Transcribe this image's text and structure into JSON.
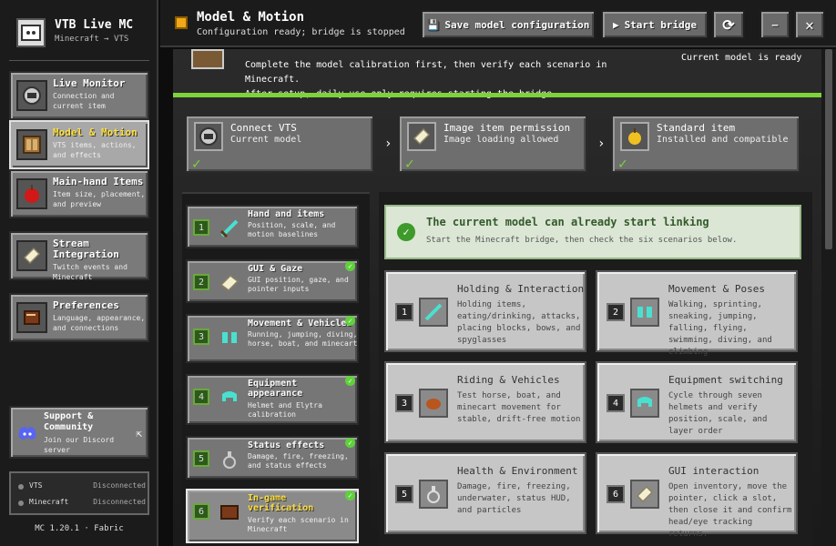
{
  "app": {
    "title": "VTB Live MC",
    "subtitle": "Minecraft → VTS"
  },
  "nav": [
    {
      "title": "Live Monitor",
      "desc": "Connection and current item",
      "icon": "monitor-icon"
    },
    {
      "title": "Model & Motion",
      "desc": "VTS items, actions, and effects",
      "icon": "cabinet-icon",
      "active": true
    },
    {
      "title": "Main-hand Items",
      "desc": "Item size, placement, and preview",
      "icon": "apple-icon"
    },
    {
      "title": "Stream Integration",
      "desc": "Twitch events and Minecraft",
      "icon": "paper-icon"
    },
    {
      "title": "Preferences",
      "desc": "Language, appearance, and connections",
      "icon": "book-icon"
    }
  ],
  "support": {
    "title": "Support & Community",
    "desc": "Join our Discord server"
  },
  "status": [
    {
      "label": "VTS",
      "value": "Disconnected"
    },
    {
      "label": "Minecraft",
      "value": "Disconnected"
    }
  ],
  "version": "MC 1.20.1 · Fabric",
  "header": {
    "title": "Model & Motion",
    "subtitle": "Configuration ready; bridge is stopped",
    "save_label": "Save model configuration",
    "start_label": "Start bridge"
  },
  "intro": {
    "line1": "Complete the model calibration first, then verify each scenario in Minecraft.",
    "line2": "After setup, daily use only requires starting the bridge.",
    "right": "Current model is ready"
  },
  "steps": [
    {
      "title": "Connect VTS",
      "desc": "Current model"
    },
    {
      "title": "Image item permission",
      "desc": "Image loading allowed"
    },
    {
      "title": "Standard item",
      "desc": "Installed and compatible"
    }
  ],
  "scenarios": [
    {
      "num": "1",
      "title": "Hand and items",
      "desc": "Position, scale, and motion baselines"
    },
    {
      "num": "2",
      "title": "GUI & Gaze",
      "desc": "GUI position, gaze, and pointer inputs"
    },
    {
      "num": "3",
      "title": "Movement & Vehicles",
      "desc": "Running, jumping, diving, horse, boat, and minecart"
    },
    {
      "num": "4",
      "title": "Equipment appearance",
      "desc": "Helmet and Elytra calibration"
    },
    {
      "num": "5",
      "title": "Status effects",
      "desc": "Damage, fire, freezing, and status effects"
    },
    {
      "num": "6",
      "title": "In-game verification",
      "desc": "Verify each scenario in Minecraft"
    }
  ],
  "ready": {
    "title": "The current model can already start linking",
    "desc": "Start the Minecraft bridge, then check the six scenarios below."
  },
  "cards": [
    {
      "num": "1",
      "title": "Holding & Interaction",
      "desc": "Holding items, eating/drinking, attacks, placing blocks, bows, and spyglasses"
    },
    {
      "num": "2",
      "title": "Movement & Poses",
      "desc": "Walking, sprinting, sneaking, jumping, falling, flying, swimming, diving, and climbing"
    },
    {
      "num": "3",
      "title": "Riding & Vehicles",
      "desc": "Test horse, boat, and minecart movement for stable, drift-free motion"
    },
    {
      "num": "4",
      "title": "Equipment switching",
      "desc": "Cycle through seven helmets and verify position, scale, and layer order"
    },
    {
      "num": "5",
      "title": "Health & Environment",
      "desc": "Damage, fire, freezing, underwater, status HUD, and particles"
    },
    {
      "num": "6",
      "title": "GUI interaction",
      "desc": "Open inventory, move the pointer, click a slot, then close it and confirm head/eye tracking returns."
    }
  ]
}
